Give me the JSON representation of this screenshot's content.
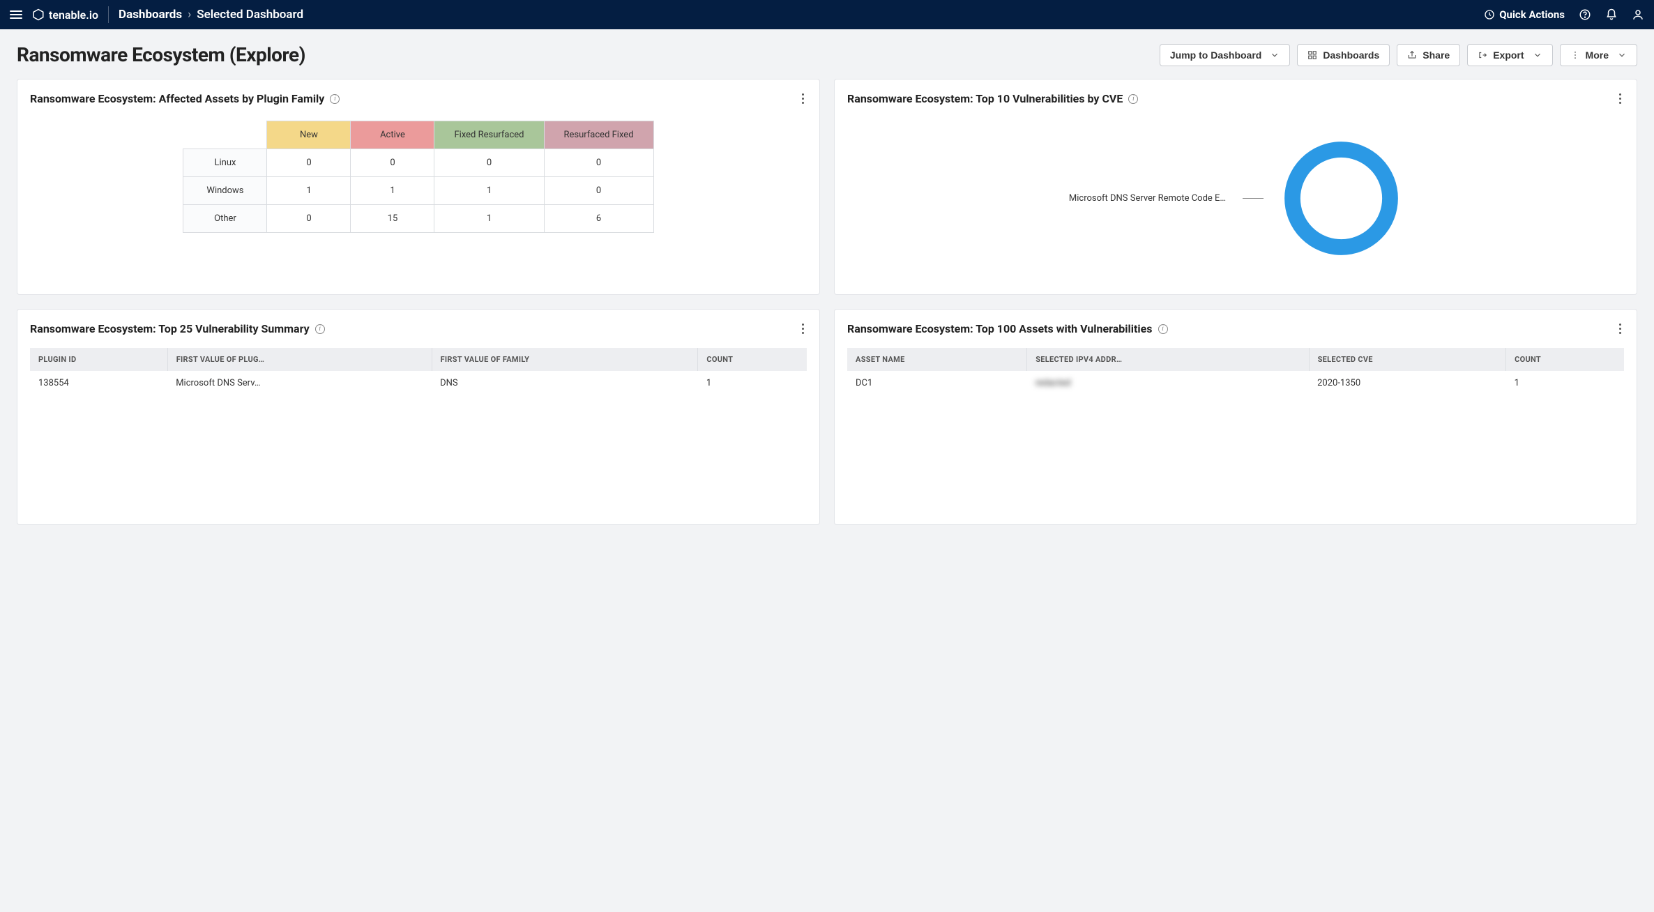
{
  "header": {
    "brand": "tenable.io",
    "breadcrumb_main": "Dashboards",
    "breadcrumb_sub": "Selected Dashboard",
    "quick_actions": "Quick Actions"
  },
  "page": {
    "title": "Ransomware Ecosystem (Explore)"
  },
  "toolbar": {
    "jump": "Jump to Dashboard",
    "dashboards": "Dashboards",
    "share": "Share",
    "export": "Export",
    "more": "More"
  },
  "cards": {
    "affected_assets": {
      "title": "Ransomware Ecosystem: Affected Assets by Plugin Family",
      "columns": [
        "New",
        "Active",
        "Fixed Resurfaced",
        "Resurfaced Fixed"
      ],
      "rows": [
        {
          "label": "Linux",
          "values": [
            "0",
            "0",
            "0",
            "0"
          ]
        },
        {
          "label": "Windows",
          "values": [
            "1",
            "1",
            "1",
            "0"
          ]
        },
        {
          "label": "Other",
          "values": [
            "0",
            "15",
            "1",
            "6"
          ]
        }
      ]
    },
    "top_cve": {
      "title": "Ransomware Ecosystem: Top 10 Vulnerabilities by CVE",
      "label": "Microsoft DNS Server Remote Code E…",
      "color": "#2b99e5"
    },
    "vuln_summary": {
      "title": "Ransomware Ecosystem: Top 25 Vulnerability Summary",
      "columns": [
        "PLUGIN ID",
        "FIRST VALUE OF PLUG…",
        "FIRST VALUE OF FAMILY",
        "COUNT"
      ],
      "rows": [
        {
          "plugin_id": "138554",
          "plug": "Microsoft DNS Serv…",
          "family": "DNS",
          "count": "1"
        }
      ]
    },
    "top_assets": {
      "title": "Ransomware Ecosystem: Top 100 Assets with Vulnerabilities",
      "columns": [
        "ASSET NAME",
        "SELECTED IPV4 ADDR…",
        "SELECTED CVE",
        "COUNT"
      ],
      "rows": [
        {
          "asset": "DC1",
          "ipv4": "redacted",
          "cve": "2020-1350",
          "count": "1"
        }
      ]
    }
  },
  "chart_data": {
    "type": "pie",
    "title": "Ransomware Ecosystem: Top 10 Vulnerabilities by CVE",
    "series": [
      {
        "name": "Microsoft DNS Server Remote Code Execution",
        "value": 1,
        "color": "#2b99e5"
      }
    ]
  }
}
